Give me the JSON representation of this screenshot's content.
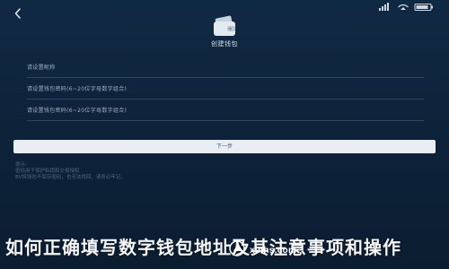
{
  "header": {
    "back_icon": "back-chevron-icon",
    "status_icons": [
      "signal-icon",
      "wifi-icon",
      "battery-icon"
    ],
    "wallet_icon": "wallet-icon",
    "title": "创建钱包"
  },
  "form": {
    "fields": [
      {
        "placeholder": "请设置昵称"
      },
      {
        "placeholder": "请设置钱包密码(6~20位字母数字组合)"
      },
      {
        "placeholder": "请设置钱包密码(6~20位字母数字组合)"
      }
    ],
    "next_label": "下一步"
  },
  "notes": {
    "lines": [
      "提示:",
      "密码用于保护私钥和交易授权",
      "BV将钱包不保存密码，也无法找回，请务必牢记。"
    ]
  },
  "watermark": {
    "banner_text": "如何正确填写数字钱包地址及其注意事项和操作",
    "site_text": "xinhs.com"
  },
  "colors": {
    "background": "#0d2239",
    "button": "#e9eef4",
    "text_primary": "#d7e0ea",
    "text_muted": "#9fb0c2"
  }
}
